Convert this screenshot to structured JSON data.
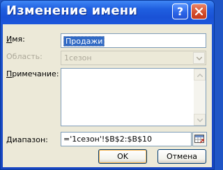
{
  "dialog": {
    "title": "Изменение имени",
    "help_glyph": "?",
    "close_icon": "close-icon",
    "accent_color": "#1f55c6"
  },
  "fields": {
    "name": {
      "label_prefix": "",
      "label_hot": "И",
      "label_rest": "мя:",
      "value": "Продажи"
    },
    "scope": {
      "label": "Область:",
      "value": "1сезон"
    },
    "comment": {
      "label_prefix": "",
      "label_hot": "П",
      "label_rest": "римечание:",
      "value": ""
    },
    "range": {
      "label_prefix": "",
      "label_hot": "Д",
      "label_rest": "иапазон:",
      "value": "='1сезон'!$B$2:$B$10"
    }
  },
  "buttons": {
    "ok": "OK",
    "cancel": "Отмена"
  }
}
